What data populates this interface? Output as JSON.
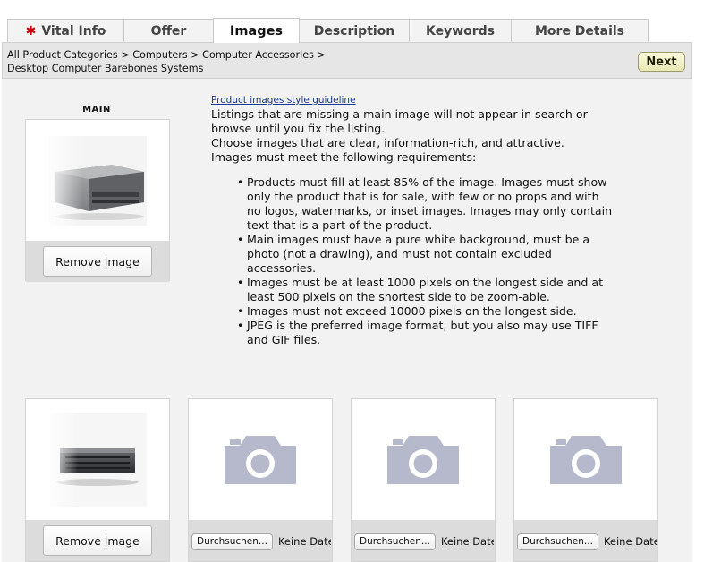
{
  "tabs": [
    {
      "label": "Vital Info",
      "required_marker": "✱",
      "active": false
    },
    {
      "label": "Offer",
      "active": false
    },
    {
      "label": "Images",
      "active": true
    },
    {
      "label": "Description",
      "active": false
    },
    {
      "label": "Keywords",
      "active": false
    },
    {
      "label": "More Details",
      "active": false
    }
  ],
  "category": {
    "line1": "All Product Categories > Computers > Computer Accessories >",
    "line2": "Desktop Computer Barebones Systems",
    "next_label": "Next"
  },
  "main_slot": {
    "label": "MAIN",
    "remove_label": "Remove image"
  },
  "guideline": {
    "link": "Product images style guideline",
    "intro": [
      "Listings that are missing a main image will not appear in search or browse until you fix the listing.",
      "Choose images that are clear, information-rich, and attractive.",
      "Images must meet the following requirements:"
    ],
    "requirements": [
      "Products must fill at least 85% of the image. Images must show only the product that is for sale, with few or no props and with no logos, watermarks, or inset images. Images may only contain text that is a part of the product.",
      "Main images must have a pure white background, must be a photo (not a drawing), and must not contain excluded accessories.",
      "Images must be at least 1000 pixels on the longest side and at least 500 pixels on the shortest side to be zoom-able.",
      "Images must not exceed 10000 pixels on the longest side.",
      "JPEG is the preferred image format, but you also may use TIFF and GIF files."
    ]
  },
  "slots": [
    {
      "type": "image",
      "remove_label": "Remove image"
    },
    {
      "type": "empty",
      "browse_label": "Durchsuchen...",
      "no_file": "Keine Datei ausgewählt."
    },
    {
      "type": "empty",
      "browse_label": "Durchsuchen...",
      "no_file": "Keine Datei ausgewählt."
    },
    {
      "type": "empty",
      "browse_label": "Durchsuchen...",
      "no_file": "Keine Datei ausgewählt."
    }
  ],
  "icons": {
    "placeholder": "camera-icon"
  },
  "colors": {
    "placeholder_camera": "#b5b9cb",
    "required_star": "#c40000",
    "link": "#1b3a92"
  }
}
